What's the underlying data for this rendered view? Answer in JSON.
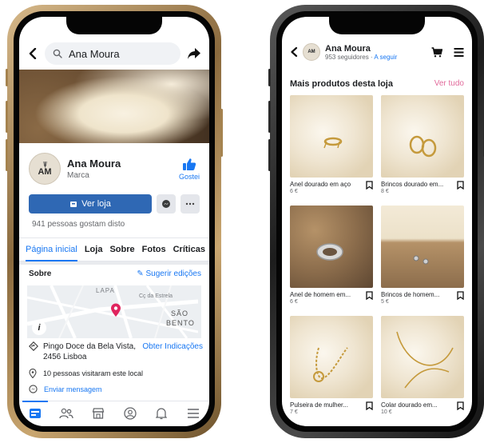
{
  "left_phone": {
    "search": {
      "value": "Ana Moura"
    },
    "page": {
      "avatar_text": "AM",
      "name": "Ana Moura",
      "category": "Marca",
      "like_label": "Gostei"
    },
    "actions": {
      "shop_label": "Ver loja"
    },
    "likes_text": "941 pessoas gostam disto",
    "tabs": [
      "Página inicial",
      "Loja",
      "Sobre",
      "Fotos",
      "Críticas"
    ],
    "about": {
      "heading": "Sobre",
      "suggest_edits": "Sugerir edições",
      "map_labels": {
        "lapa": "LAPA",
        "street": "Cç da Estrela",
        "sao": "SÃO",
        "bento": "BENTO"
      },
      "address": "Pingo Doce da Bela Vista, 2456 Lisboa",
      "directions": "Obter Indicações",
      "visits": "10 pessoas visitaram este local",
      "message": "Enviar mensagem"
    },
    "bottom_nav": [
      "home-icon",
      "friends-icon",
      "marketplace-icon",
      "profile-icon",
      "notifications-icon",
      "menu-icon"
    ]
  },
  "right_phone": {
    "header": {
      "avatar_text": "AM",
      "name": "Ana Moura",
      "followers": "953 seguidores · ",
      "follow": "A seguir"
    },
    "section": {
      "title": "Mais produtos desta loja",
      "see_all": "Ver tudo"
    },
    "products": [
      {
        "name": "Anel dourado em aço",
        "price": "6 €"
      },
      {
        "name": "Brincos dourado em...",
        "price": "8 €"
      },
      {
        "name": "Anel de homem em...",
        "price": "6 €"
      },
      {
        "name": "Brincos de homem...",
        "price": "5 €"
      },
      {
        "name": "Pulseira de mulher...",
        "price": "7 €"
      },
      {
        "name": "Colar dourado em...",
        "price": "10 €"
      }
    ]
  },
  "colors": {
    "facebook_blue": "#1877f2",
    "shop_button": "#2f68b4",
    "accent_pink": "#e26a9b"
  }
}
